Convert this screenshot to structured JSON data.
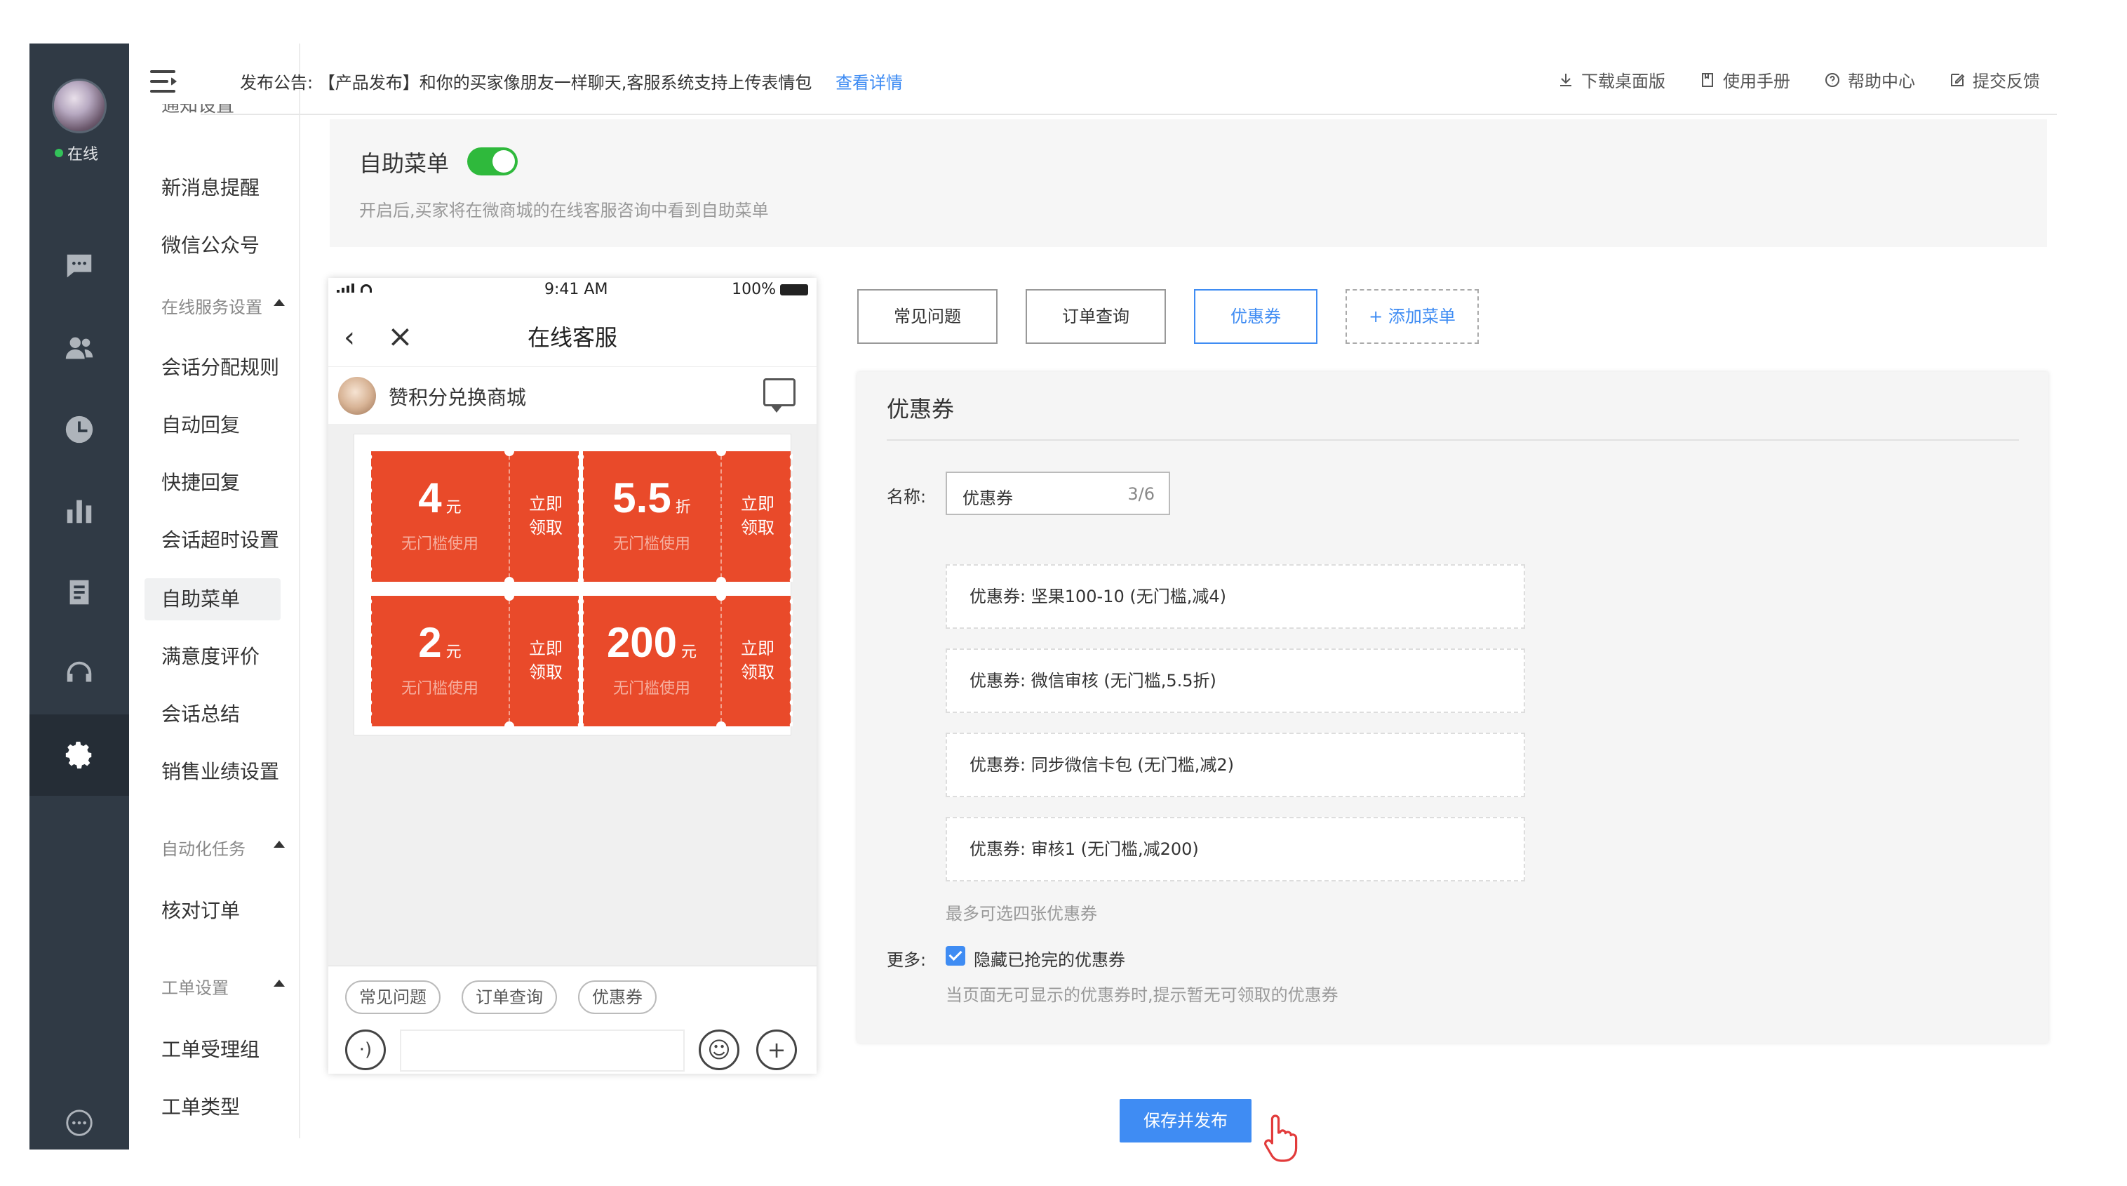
{
  "rail": {
    "status": "在线",
    "icons": [
      "chat-icon",
      "contacts-icon",
      "history-icon",
      "stats-icon",
      "clipboard-icon",
      "headset-icon",
      "settings-icon",
      "more-icon"
    ]
  },
  "menu": {
    "partial_top": "通知设置",
    "items_top": [
      "新消息提醒",
      "微信公众号"
    ],
    "section_online": "在线服务设置",
    "items_online": [
      "会话分配规则",
      "自动回复",
      "快捷回复",
      "会话超时设置",
      "自助菜单",
      "满意度评价",
      "会话总结",
      "销售业绩设置"
    ],
    "section_auto": "自动化任务",
    "items_auto": [
      "核对订单"
    ],
    "section_ticket": "工单设置",
    "items_ticket": [
      "工单受理组",
      "工单类型"
    ]
  },
  "topbar": {
    "notice_prefix": "发布公告:",
    "notice_text": "【产品发布】和你的买家像朋友一样聊天,客服系统支持上传表情包",
    "notice_link": "查看详情",
    "actions": [
      "下载桌面版",
      "使用手册",
      "帮助中心",
      "提交反馈"
    ]
  },
  "toggle": {
    "title": "自助菜单",
    "enabled": true,
    "desc": "开启后,买家将在微商城的在线客服咨询中看到自助菜单"
  },
  "phone": {
    "time": "9:41 AM",
    "battery": "100%",
    "title": "在线客服",
    "shop_name": "赞积分兑换商城",
    "coupons": [
      {
        "amount": "4",
        "unit": "元",
        "condition": "无门槛使用",
        "action_line1": "立即",
        "action_line2": "领取"
      },
      {
        "amount": "5.5",
        "unit": "折",
        "condition": "无门槛使用",
        "action_line1": "立即",
        "action_line2": "领取"
      },
      {
        "amount": "2",
        "unit": "元",
        "condition": "无门槛使用",
        "action_line1": "立即",
        "action_line2": "领取"
      },
      {
        "amount": "200",
        "unit": "元",
        "condition": "无门槛使用",
        "action_line1": "立即",
        "action_line2": "领取"
      }
    ],
    "chips": [
      "常见问题",
      "订单查询",
      "优惠券"
    ]
  },
  "editor": {
    "tabs": [
      "常见问题",
      "订单查询",
      "优惠券",
      "+ 添加菜单"
    ],
    "active_tab": "优惠券",
    "title": "优惠券",
    "name_label": "名称:",
    "name_value": "优惠券",
    "name_count": "3/6",
    "coupon_items": [
      "优惠券: 坚果100-10 (无门槛,减4)",
      "优惠券: 微信审核 (无门槛,5.5折)",
      "优惠券: 同步微信卡包 (无门槛,减2)",
      "优惠券: 审核1 (无门槛,减200)"
    ],
    "max_hint": "最多可选四张优惠券",
    "more_label": "更多:",
    "hide_checkbox_label": "隐藏已抢完的优惠券",
    "hide_checked": true,
    "hide_hint": "当页面无可显示的优惠券时,提示暂无可领取的优惠券"
  },
  "save_button": "保存并发布",
  "colors": {
    "rail_bg": "#303a45",
    "accent": "#3f8cf3",
    "toggle_on": "#2fb93c",
    "coupon_red": "#e94a2a"
  }
}
